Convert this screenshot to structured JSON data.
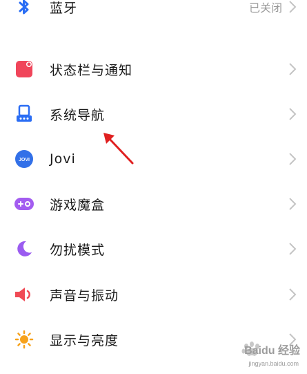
{
  "settings": {
    "items": [
      {
        "label": "蓝牙",
        "value": "已关闭",
        "icon": "bluetooth-icon"
      },
      {
        "label": "状态栏与通知",
        "icon": "status-bar-icon"
      },
      {
        "label": "系统导航",
        "icon": "system-navigation-icon"
      },
      {
        "label": "Jovi",
        "icon": "jovi-icon",
        "icon_text": "JOVI"
      },
      {
        "label": "游戏魔盒",
        "icon": "game-box-icon"
      },
      {
        "label": "勿扰模式",
        "icon": "moon-icon"
      },
      {
        "label": "声音与振动",
        "icon": "speaker-icon"
      },
      {
        "label": "显示与亮度",
        "icon": "sun-icon"
      }
    ]
  },
  "colors": {
    "bluetooth": "#2a6df4",
    "status_bar": "#f0455a",
    "system_nav": "#2a6df4",
    "jovi": "#3270e8",
    "game_box": "#a35cf0",
    "moon": "#9b5cf0",
    "speaker": "#f04a55",
    "sun": "#f7a21b",
    "annotation_arrow": "#e02020"
  },
  "watermark": {
    "brand": "Baidu 经验",
    "url": "jingyan.baidu.com"
  }
}
